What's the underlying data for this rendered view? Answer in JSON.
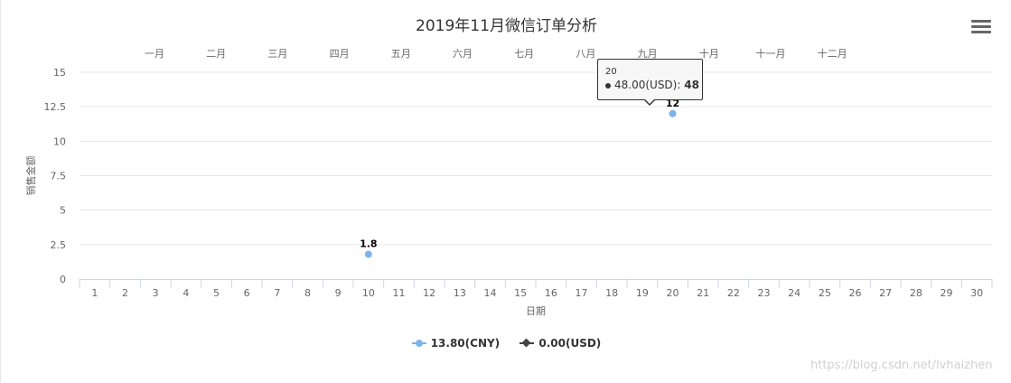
{
  "chart_data": {
    "type": "line",
    "title": "2019年11月微信订单分析",
    "xlabel": "日期",
    "ylabel": "销售金额",
    "x": [
      "1",
      "2",
      "3",
      "4",
      "5",
      "6",
      "7",
      "8",
      "9",
      "10",
      "11",
      "12",
      "13",
      "14",
      "15",
      "16",
      "17",
      "18",
      "19",
      "20",
      "21",
      "22",
      "23",
      "24",
      "25",
      "26",
      "27",
      "28",
      "29",
      "30"
    ],
    "top_axis_labels": [
      "一月",
      "二月",
      "三月",
      "四月",
      "五月",
      "六月",
      "七月",
      "八月",
      "九月",
      "十月",
      "十一月",
      "十二月"
    ],
    "yticks": [
      "0",
      "2.5",
      "5",
      "7.5",
      "10",
      "12.5",
      "15"
    ],
    "ylim": [
      0,
      15
    ],
    "grid": true,
    "legend_position": "bottom-center",
    "series": [
      {
        "name": "13.80(CNY)",
        "color": "#7cb5ec",
        "marker": "circle",
        "points": [
          {
            "x": 10,
            "y": 1.8,
            "label": "1.8"
          },
          {
            "x": 20,
            "y": 12,
            "label": "12"
          }
        ]
      },
      {
        "name": "0.00(USD)",
        "color": "#434348",
        "marker": "diamond",
        "points": []
      }
    ],
    "tooltip": {
      "header": "20",
      "series_name": "48.00(USD)",
      "value": "48"
    }
  },
  "menu_icon": "hamburger-menu-icon",
  "watermark": "https://blog.csdn.net/lvhaizhen"
}
